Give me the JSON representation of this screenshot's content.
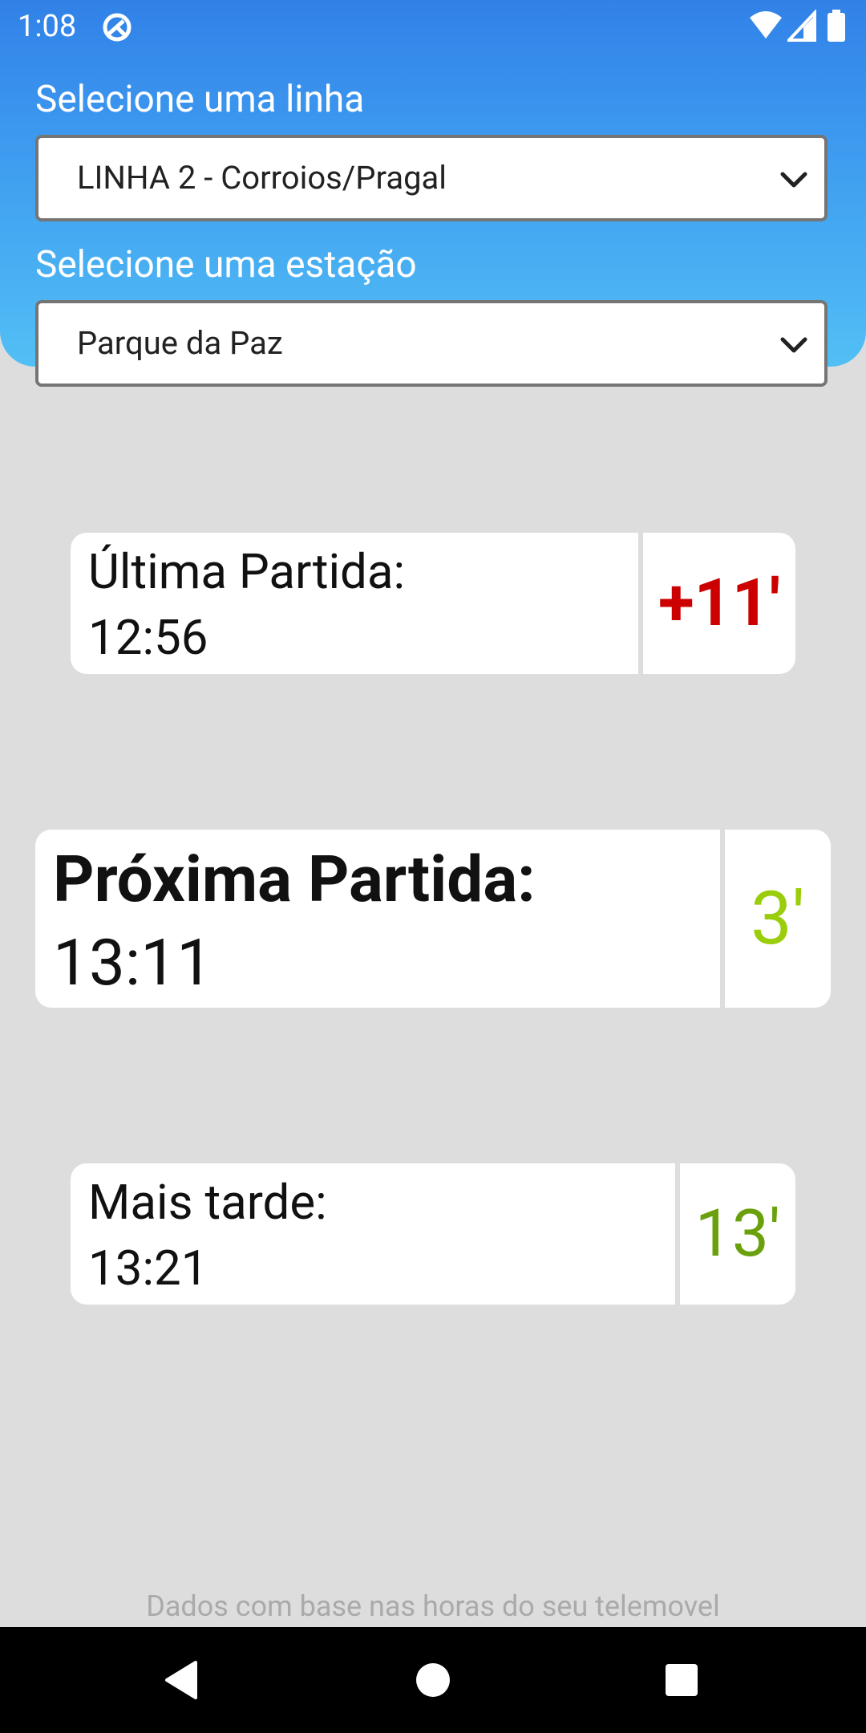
{
  "status_bar": {
    "time": "1:08",
    "icons": [
      "sync-icon",
      "wifi-icon",
      "signal-icon",
      "battery-icon"
    ]
  },
  "line_select": {
    "label": "Selecione uma linha",
    "value": "LINHA 2 - Corroios/Pragal"
  },
  "station_select": {
    "label": "Selecione uma estação",
    "value": "Parque da Paz"
  },
  "last_departure": {
    "label": "Última Partida:",
    "time": "12:56",
    "minutes": "+11'"
  },
  "next_departure": {
    "label": "Próxima Partida:",
    "time": "13:11",
    "minutes": "3'"
  },
  "later_departure": {
    "label": "Mais tarde:",
    "time": "13:21",
    "minutes": "13'"
  },
  "footer_note": "Dados com base nas horas do seu telemovel",
  "colors": {
    "header_top": "#3181e8",
    "header_bottom": "#52bff5",
    "late_red": "#cc0000",
    "next_green": "#9acd0a",
    "later_green": "#6aa00c",
    "background": "#dddddd"
  },
  "nav_bar": {
    "icons": [
      "back-icon",
      "home-icon",
      "recents-icon"
    ]
  }
}
